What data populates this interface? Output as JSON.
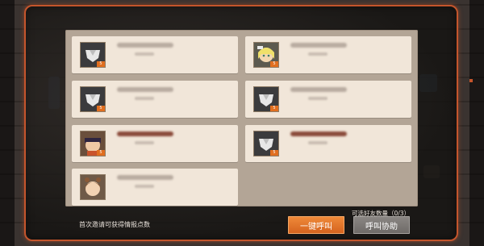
{
  "dialog": {
    "first_invite_text": "首次邀请可获得情报点数",
    "friend_count_label": "可选好友数量（0/3）",
    "buttons": {
      "call_all": "一键呼叫",
      "call_assist": "呼叫协助"
    }
  },
  "friends": [
    {
      "portrait": "default-silhouette-icon",
      "level": "",
      "name_color": "gray"
    },
    {
      "portrait": "blonde-girl-portrait",
      "level": "",
      "name_color": "gray"
    },
    {
      "portrait": "default-silhouette-icon",
      "level": "",
      "name_color": "gray"
    },
    {
      "portrait": "default-silhouette-icon",
      "level": "",
      "name_color": "gray"
    },
    {
      "portrait": "dark-hair-girl-portrait",
      "level": "",
      "name_color": "red"
    },
    {
      "portrait": "default-silhouette-icon",
      "level": "",
      "name_color": "red"
    },
    {
      "portrait": "brown-hair-girl-portrait",
      "level": "",
      "name_color": "gray"
    }
  ],
  "colors": {
    "frame_accent": "#c4552c",
    "primary_button": "#e07428",
    "secondary_button": "#7d7976",
    "card_bg": "#f1e6d9",
    "panel_bg": "#b3a596"
  }
}
